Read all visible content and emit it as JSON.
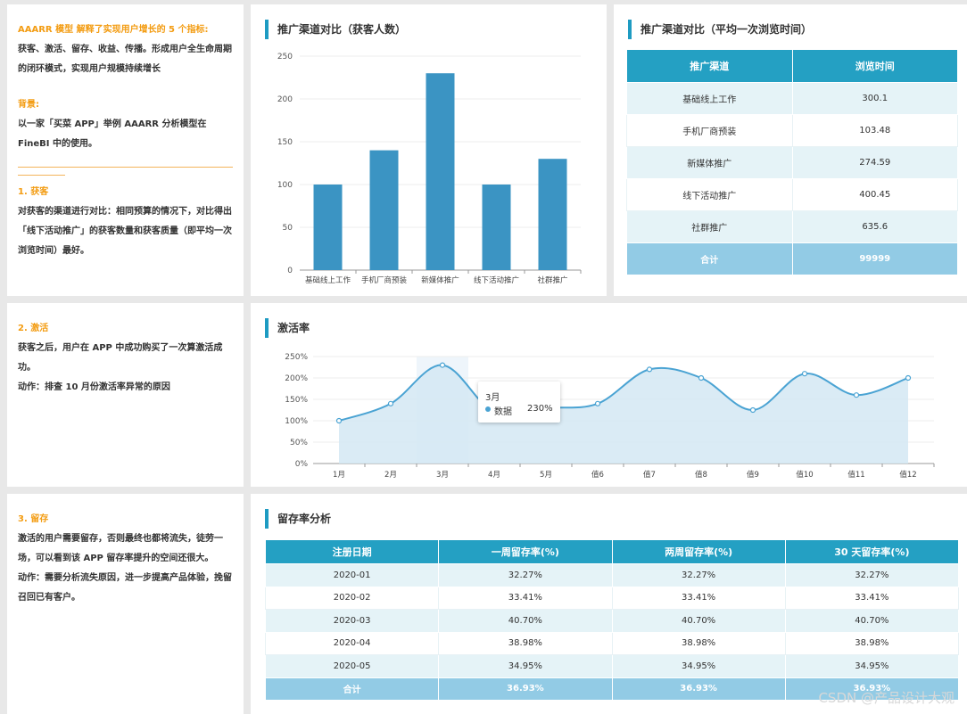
{
  "intro": {
    "heading": "AAARR 模型 解释了实现用户增长的 5 个指标:",
    "desc": "获客、激活、留存、收益、传播。形成用户全生命周期的闭环模式，实现用户规模持续增长",
    "bg_label": "背景:",
    "bg_text": "以一家「买菜 APP」举例 AAARR 分析模型在 FineBI 中的使用。",
    "s1_title": "1. 获客",
    "s1_text": "对获客的渠道进行对比：相同预算的情况下，对比得出「线下活动推广」的获客数量和获客质量（即平均一次浏览时间）最好。"
  },
  "activation_note": {
    "title": "2. 激活",
    "text": "获客之后，用户在 APP 中成功购买了一次算激活成功。",
    "action": "动作：排查 10 月份激活率异常的原因"
  },
  "retention_note": {
    "title": "3. 留存",
    "text": "激活的用户需要留存，否则最终也都将流失，徒劳一场，可以看到该 APP 留存率提升的空间还很大。",
    "action": "动作：需要分析流失原因，进一步提高产品体验，挽留召回已有客户。"
  },
  "bar_panel": {
    "title": "推广渠道对比（获客人数）"
  },
  "channel_table": {
    "title": "推广渠道对比（平均一次浏览时间）",
    "headers": [
      "推广渠道",
      "浏览时间"
    ],
    "rows": [
      [
        "基础线上工作",
        "300.1"
      ],
      [
        "手机厂商预装",
        "103.48"
      ],
      [
        "新媒体推广",
        "274.59"
      ],
      [
        "线下活动推广",
        "400.45"
      ],
      [
        "社群推广",
        "635.6"
      ]
    ],
    "total": [
      "合计",
      "99999"
    ]
  },
  "line_panel": {
    "title": "激活率",
    "tooltip": {
      "header": "3月",
      "label": "数据",
      "value": "230%"
    }
  },
  "retention_table": {
    "title": "留存率分析",
    "headers": [
      "注册日期",
      "一周留存率(%)",
      "两周留存率(%)",
      "30 天留存率(%)"
    ],
    "rows": [
      [
        "2020-01",
        "32.27%",
        "32.27%",
        "32.27%"
      ],
      [
        "2020-02",
        "33.41%",
        "33.41%",
        "33.41%"
      ],
      [
        "2020-03",
        "40.70%",
        "40.70%",
        "40.70%"
      ],
      [
        "2020-04",
        "38.98%",
        "38.98%",
        "38.98%"
      ],
      [
        "2020-05",
        "34.95%",
        "34.95%",
        "34.95%"
      ]
    ],
    "total": [
      "合计",
      "36.93%",
      "36.93%",
      "36.93%"
    ]
  },
  "watermark": "CSDN @产品设计大观",
  "colors": {
    "accent": "#1e9bc2",
    "bar": "#3b94c3",
    "line": "#4aa3d3",
    "area": "#d4e7f3",
    "orange": "#f39c12"
  },
  "chart_data": [
    {
      "type": "bar",
      "categories": [
        "基础线上工作",
        "手机厂商预装",
        "新媒体推广",
        "线下活动推广",
        "社群推广"
      ],
      "values": [
        100,
        140,
        230,
        100,
        130
      ],
      "ylim": [
        0,
        250
      ],
      "yticks": [
        0,
        50,
        100,
        150,
        200,
        250
      ],
      "grid": true
    },
    {
      "type": "area",
      "categories": [
        "1月",
        "2月",
        "3月",
        "4月",
        "5月",
        "值6",
        "值7",
        "值8",
        "值9",
        "值10",
        "值11",
        "值12"
      ],
      "values": [
        100,
        140,
        230,
        120,
        130,
        140,
        220,
        200,
        125,
        210,
        160,
        200
      ],
      "ylim": [
        0,
        250
      ],
      "yticks": [
        "0%",
        "50%",
        "100%",
        "150%",
        "200%",
        "250%"
      ],
      "grid": true
    }
  ]
}
